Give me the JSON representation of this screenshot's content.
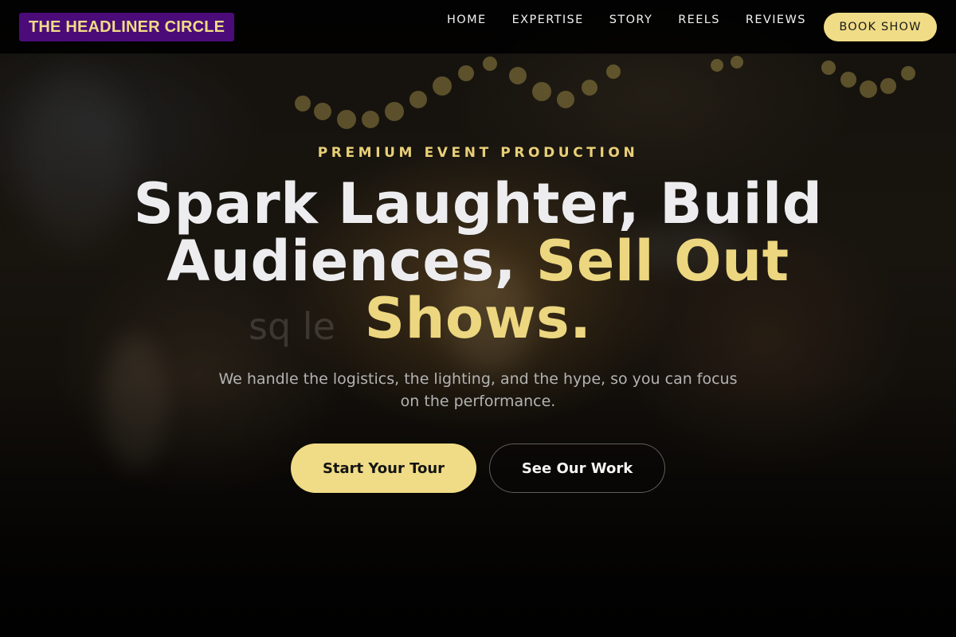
{
  "nav": {
    "logo": "THE HEADLINER CIRCLE",
    "links": [
      "HOME",
      "EXPERTISE",
      "STORY",
      "REELS",
      "REVIEWS"
    ],
    "cta_label": "BOOK SHOW"
  },
  "hero": {
    "eyebrow": "PREMIUM EVENT PRODUCTION",
    "headline_part1": "Spark Laughter, Build Audiences,",
    "headline_accent": "Sell Out Shows.",
    "ghost_text": "sq         le",
    "subhead": "We handle the logistics, the lighting, and the hype, so you can focus on the performance.",
    "primary_cta": "Start Your Tour",
    "secondary_cta": "See Our Work"
  },
  "colors": {
    "accent": "#f0dc86",
    "logo_background": "#4b0c7a",
    "nav_background": "#000000"
  }
}
